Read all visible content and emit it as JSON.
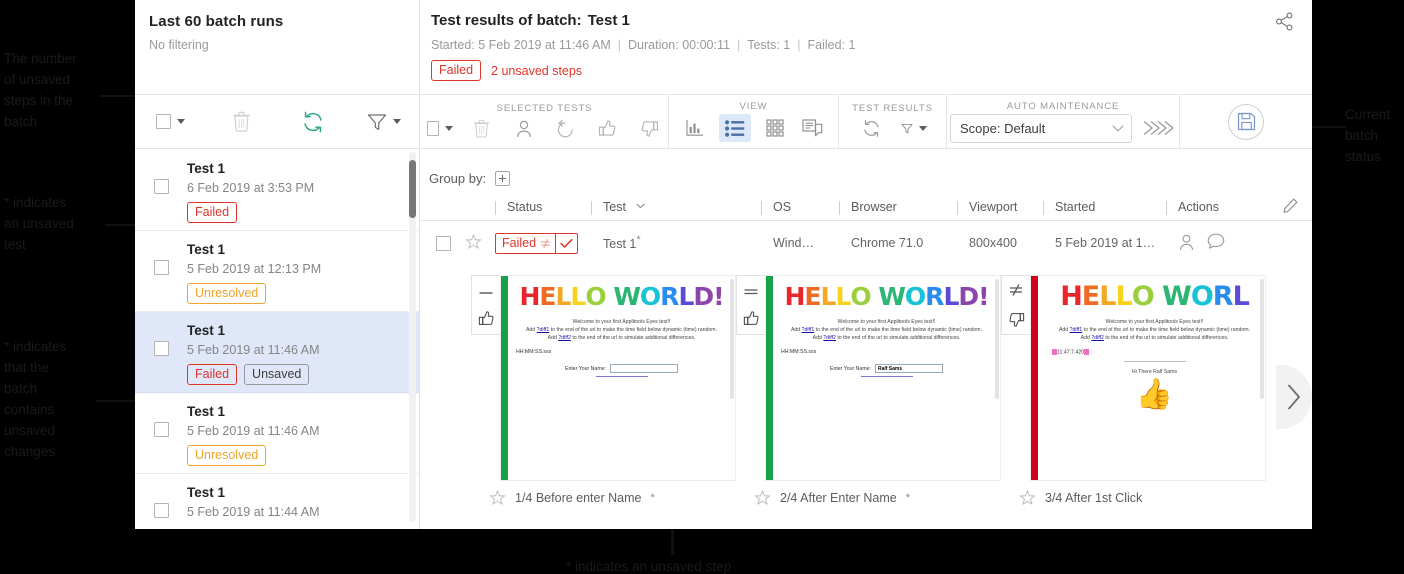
{
  "annotations": {
    "unsaved_steps_count": "The number\nof unsaved\nsteps in the\nbatch",
    "unsaved_test": "* indicates\nan unsaved\ntest",
    "unsaved_batch": "* indicates\nthat the\nbatch\ncontains\nunsaved\nchanges",
    "current_batch_status": "Current\nbatch\nstatus",
    "unsaved_step": "* indicates an unsaved step"
  },
  "left_panel": {
    "title": "Last 60 batch runs",
    "subtitle": "No filtering",
    "toolbar": {
      "select_all": "select-all-checkbox",
      "delete": "delete-icon",
      "refresh": "refresh-icon",
      "filter": "filter-icon"
    },
    "runs": [
      {
        "name": "Test 1",
        "date": "6 Feb 2019 at 3:53 PM",
        "badges": [
          {
            "label": "Failed",
            "kind": "failed"
          }
        ],
        "selected": false
      },
      {
        "name": "Test 1",
        "date": "5 Feb 2019 at 12:13 PM",
        "badges": [
          {
            "label": "Unresolved",
            "kind": "unresolved"
          }
        ],
        "selected": false
      },
      {
        "name": "Test 1",
        "date": "5 Feb 2019 at 11:46 AM",
        "badges": [
          {
            "label": "Failed",
            "kind": "failed"
          },
          {
            "label": "Unsaved",
            "kind": "unsaved"
          }
        ],
        "selected": true
      },
      {
        "name": "Test 1",
        "date": "5 Feb 2019 at 11:46 AM",
        "badges": [
          {
            "label": "Unresolved",
            "kind": "unresolved"
          }
        ],
        "selected": false
      },
      {
        "name": "Test 1",
        "date": "5 Feb 2019 at 11:44 AM",
        "badges": [],
        "selected": false
      }
    ]
  },
  "right_panel": {
    "title_prefix": "Test results of batch:",
    "title_value": "Test 1",
    "started_label": "Started: 5 Feb 2019 at 11:46 AM",
    "duration_label": "Duration: 00:00:11",
    "tests_label": "Tests: 1",
    "failed_label": "Failed: 1",
    "status_badge": "Failed",
    "unsaved_steps_link": "2 unsaved steps",
    "toolbar": {
      "selected_tests_label": "SELECTED TESTS",
      "view_label": "VIEW",
      "test_results_label": "TEST RESULTS",
      "auto_maintenance_label": "AUTO MAINTENANCE",
      "scope_value": "Scope: Default"
    },
    "group_by_label": "Group by:",
    "columns": [
      "Status",
      "Test",
      "OS",
      "Browser",
      "Viewport",
      "Started",
      "Actions"
    ],
    "row": {
      "status": "Failed",
      "test": "Test 1",
      "test_unsaved_mark": "*",
      "os": "Wind…",
      "browser": "Chrome 71.0",
      "viewport": "800x400",
      "started": "5 Feb 2019 at 1…"
    },
    "steps": [
      {
        "caption": "1/4 Before enter Name",
        "unsaved_mark": "*",
        "diff_icon": "minus-icon",
        "vote_icon": "thumbs-up-icon",
        "bar_color": "#18a04a"
      },
      {
        "caption": "2/4 After Enter Name",
        "unsaved_mark": "*",
        "diff_icon": "equals-icon",
        "vote_icon": "thumbs-up-icon",
        "bar_color": "#18a04a"
      },
      {
        "caption": "3/4 After 1st Click",
        "unsaved_mark": "",
        "diff_icon": "not-equal-icon",
        "vote_icon": "thumbs-down-icon",
        "bar_color": "#d0021b"
      }
    ],
    "screenshot_content": {
      "heading": "HELLO WORLD!",
      "heading_truncated": "HELLO WORL",
      "welcome": "Welcome to your first Applitools Eyes test!!",
      "line1_pre": "Add ",
      "line1_link": "?diff1",
      "line1_post": " to the end of the url to make the time field below dynamic (time) random.",
      "line2_pre": "Add ",
      "line2_link": "?diff2",
      "line2_post": " to the end of the url to simulate additional differences.",
      "time_placeholder": "HH:MM:SS.sss",
      "time_value": "11:47:7.420",
      "name_label": "Enter Your Name:",
      "name_value_empty": "",
      "name_value_filled": "Ralf Sams",
      "greeting": "Hi There Ralf Sams"
    }
  },
  "colors": {
    "failed": "#e0352b",
    "unresolved": "#efa32a",
    "pass_bar": "#18a04a",
    "fail_bar": "#d0021b",
    "accent": "#dde8f8",
    "refresh": "#2ea88a"
  }
}
